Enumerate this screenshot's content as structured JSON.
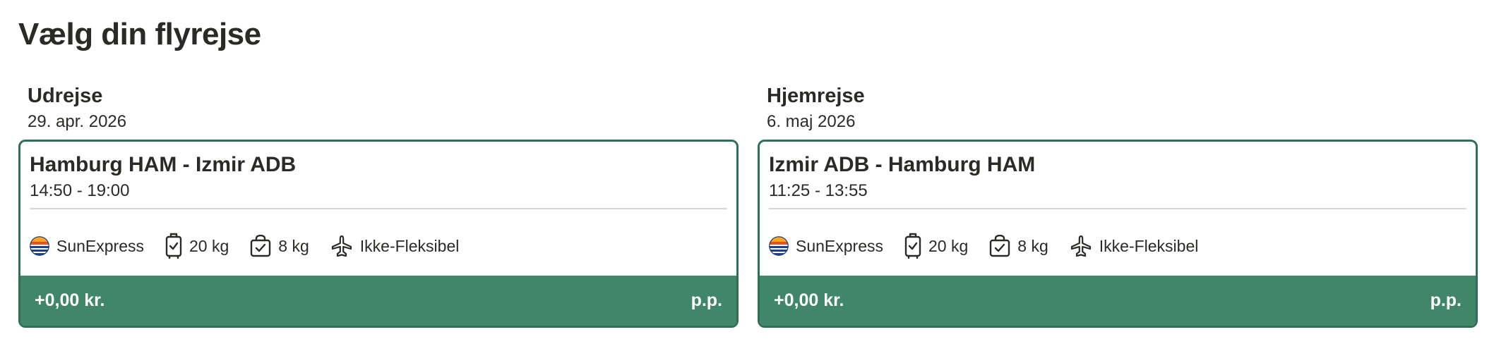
{
  "page_title": "Vælg din flyrejse",
  "outbound": {
    "heading": "Udrejse",
    "date": "29. apr. 2026",
    "route": "Hamburg HAM - Izmir ADB",
    "times": "14:50 - 19:00",
    "airline": "SunExpress",
    "checked_baggage": "20 kg",
    "hand_baggage": "8 kg",
    "flexibility": "Ikke-Fleksibel",
    "price": "+0,00 kr.",
    "price_unit": "p.p."
  },
  "return": {
    "heading": "Hjemrejse",
    "date": "6. maj 2026",
    "route": "Izmir ADB - Hamburg HAM",
    "times": "11:25 - 13:55",
    "airline": "SunExpress",
    "checked_baggage": "20 kg",
    "hand_baggage": "8 kg",
    "flexibility": "Ikke-Fleksibel",
    "price": "+0,00 kr.",
    "price_unit": "p.p."
  },
  "icons": {
    "airline": "sunexpress-logo-icon",
    "checked_baggage": "suitcase-check-icon",
    "hand_baggage": "bag-check-icon",
    "flexibility": "plane-icon"
  },
  "colors": {
    "card_border": "#2e7055",
    "price_bar": "#3f8768",
    "text": "#2c2a27",
    "divider": "#d9d7d2"
  }
}
